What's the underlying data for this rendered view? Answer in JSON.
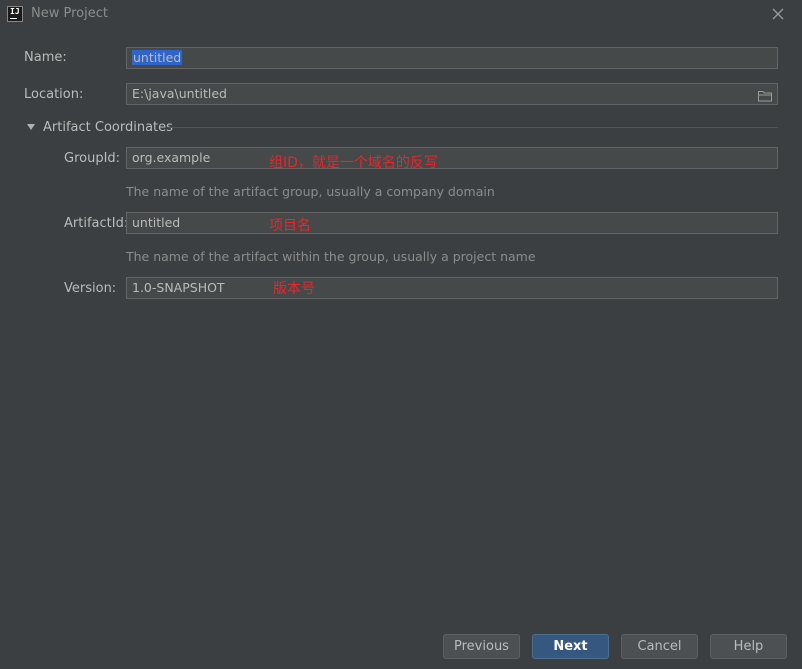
{
  "window": {
    "title": "New Project",
    "app_icon_text": "IJ"
  },
  "form": {
    "name_label": "Name:",
    "name_value": "untitled",
    "location_label": "Location:",
    "location_value": "E:\\java\\untitled",
    "section_title": "Artifact Coordinates",
    "group_id_label": "GroupId:",
    "group_id_value": "org.example",
    "group_id_annotation": "组ID，就是一个域名的反写",
    "group_id_hint": "The name of the artifact group, usually a company domain",
    "artifact_id_label": "ArtifactId:",
    "artifact_id_value": "untitled",
    "artifact_id_annotation": "项目名",
    "artifact_id_hint": "The name of the artifact within the group, usually a project name",
    "version_label": "Version:",
    "version_value": "1.0-SNAPSHOT",
    "version_annotation": "版本号"
  },
  "buttons": {
    "previous": "Previous",
    "next": "Next",
    "cancel": "Cancel",
    "help": "Help"
  },
  "colors": {
    "background": "#3c3f41",
    "field_background": "#45494a",
    "selection": "#2f65ca",
    "primary_button": "#365880",
    "annotation_red": "#e8262c"
  },
  "icons": {
    "app": "intellij-idea-icon",
    "close": "close-icon",
    "browse": "folder-icon",
    "expand": "triangle-down-icon"
  }
}
